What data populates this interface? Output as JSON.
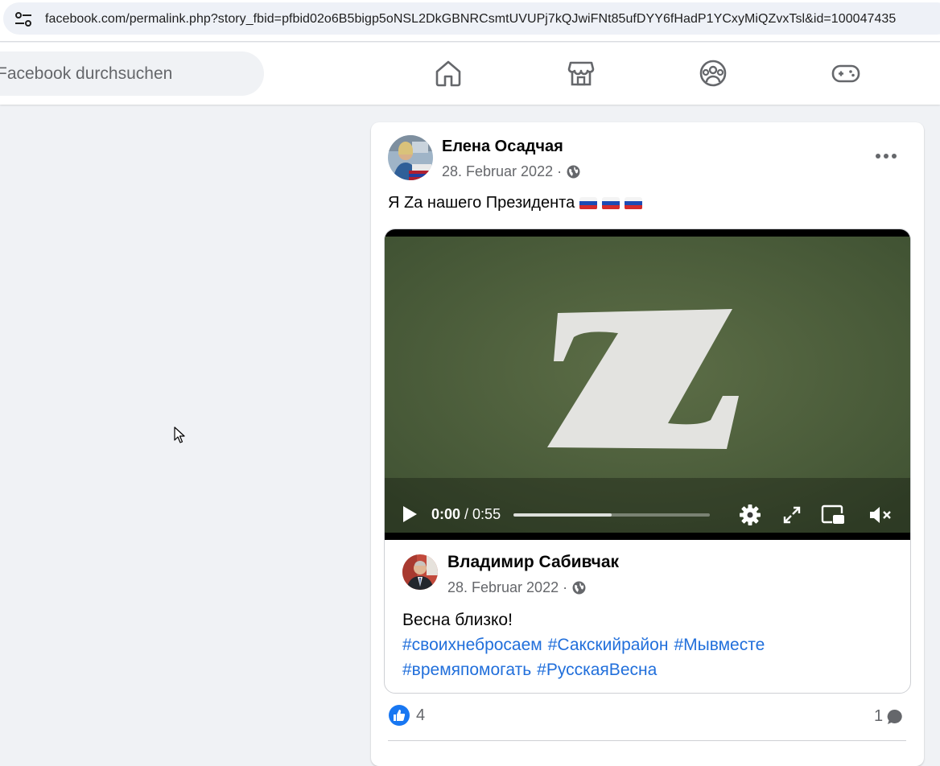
{
  "browser": {
    "url": "facebook.com/permalink.php?story_fbid=pfbid02o6B5bigp5oNSL2DkGBNRCsmtUVUPj7kQJwiFNt85ufDYY6fHadP1YCxyMiQZvxTsl&id=100047435"
  },
  "header": {
    "search_placeholder": "Facebook durchsuchen",
    "nav": [
      "home-icon",
      "marketplace-icon",
      "groups-icon",
      "gaming-icon"
    ]
  },
  "post": {
    "author": "Елена Осадчая",
    "date": "28. Februar 2022 ·",
    "text": "Я Zа нашего Президента",
    "flags": [
      "ru-flag",
      "ru-flag",
      "ru-flag"
    ],
    "shared": {
      "video": {
        "time_current": "0:00",
        "time_separator": " / ",
        "time_total": "0:55",
        "buffered_fraction": 0.5,
        "muted": true
      },
      "author": "Владимир Сабивчак",
      "date": "28. Februar 2022 ·",
      "text": "Весна близко!",
      "hashtags": [
        "#своихнебросаем",
        "#Сакскийрайон",
        "#Мывместе",
        "#времяпомогать",
        "#РусскаяВесна"
      ]
    },
    "reactions_count": "4",
    "comments_count": "1"
  },
  "colors": {
    "brand_blue": "#0866ff",
    "link_blue": "#216fdb",
    "secondary_text": "#65676b"
  }
}
